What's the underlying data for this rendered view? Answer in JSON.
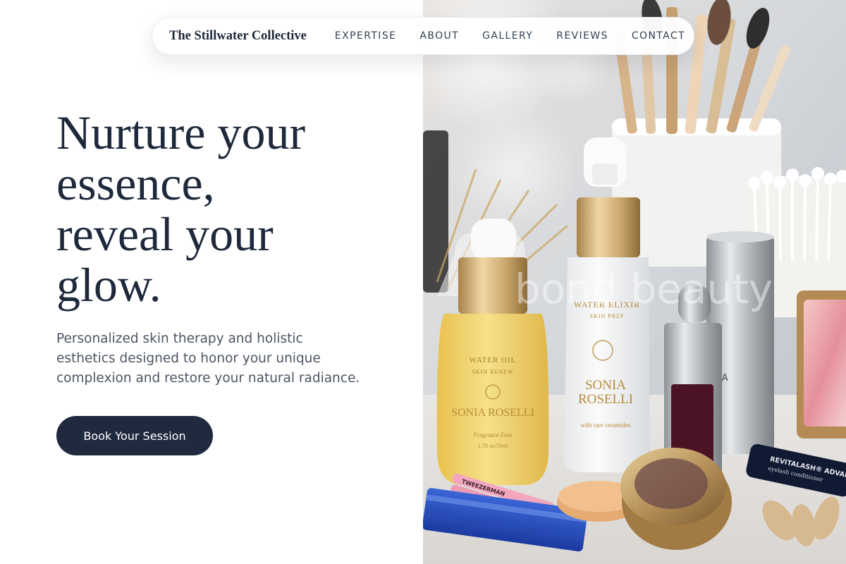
{
  "nav": {
    "brand": "The Stillwater Collective",
    "links": [
      {
        "label": "EXPERTISE"
      },
      {
        "label": "ABOUT"
      },
      {
        "label": "GALLERY"
      },
      {
        "label": "REVIEWS"
      },
      {
        "label": "CONTACT"
      }
    ]
  },
  "hero": {
    "title_lines": [
      "Nurture your",
      "essence,",
      "reveal your",
      "glow."
    ],
    "subtitle_lines": [
      "Personalized skin therapy and holistic",
      "esthetics designed to honor your unique",
      "complexion and restore your natural radiance."
    ],
    "cta_label": "Book Your Session"
  },
  "photo": {
    "watermark": "bond beauty",
    "oil_label": {
      "line1": "WATER OIL",
      "line2": "SKIN RENEW",
      "brand": "SONIA ROSELLI",
      "note1": "Fragrance Free",
      "note2": "1.7fl oz/50ml"
    },
    "elixir_label": {
      "line1": "WATER ELIXIR",
      "line2": "SKIN PREP",
      "brand_line1": "SONIA",
      "brand_line2": "ROSELLI",
      "note": "with rare ceramides"
    },
    "tube_label": {
      "line1": "REVITALASH® ADVANCED",
      "line2": "eyelash conditioner"
    },
    "tweezer_label": "TWEEZERMAN",
    "silver_label": "NA"
  },
  "colors": {
    "primary_dark": "#1f2a3f",
    "heading": "#1e293b",
    "body_text": "#4b5563"
  }
}
